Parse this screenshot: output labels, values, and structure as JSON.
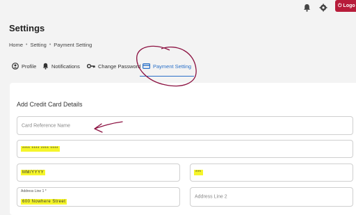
{
  "header": {
    "logout_label": "Logo"
  },
  "page": {
    "title": "Settings",
    "breadcrumb": [
      "Home",
      "Setting",
      "Payment Setting"
    ]
  },
  "tabs": [
    {
      "label": "Profile",
      "icon": "person-icon"
    },
    {
      "label": "Notifications",
      "icon": "bell-icon"
    },
    {
      "label": "Change Password",
      "icon": "key-icon"
    },
    {
      "label": "Payment Setting",
      "icon": "credit-card-icon",
      "active": true
    }
  ],
  "form": {
    "title": "Add Credit Card Details",
    "card_reference_placeholder": "Card Reference Name",
    "card_number_value": "**** **** **** ****",
    "expiry_value": "MM/YYYY",
    "cvv_value": "***",
    "address1_label": "Address Line 1 *",
    "address1_value": "600 Nowhere Street",
    "address2_placeholder": "Address Line 2"
  },
  "colors": {
    "accent": "#2a70c8",
    "logout_bg": "#b71c3a",
    "highlight": "#f5f52a",
    "annotation": "#8b1040"
  }
}
